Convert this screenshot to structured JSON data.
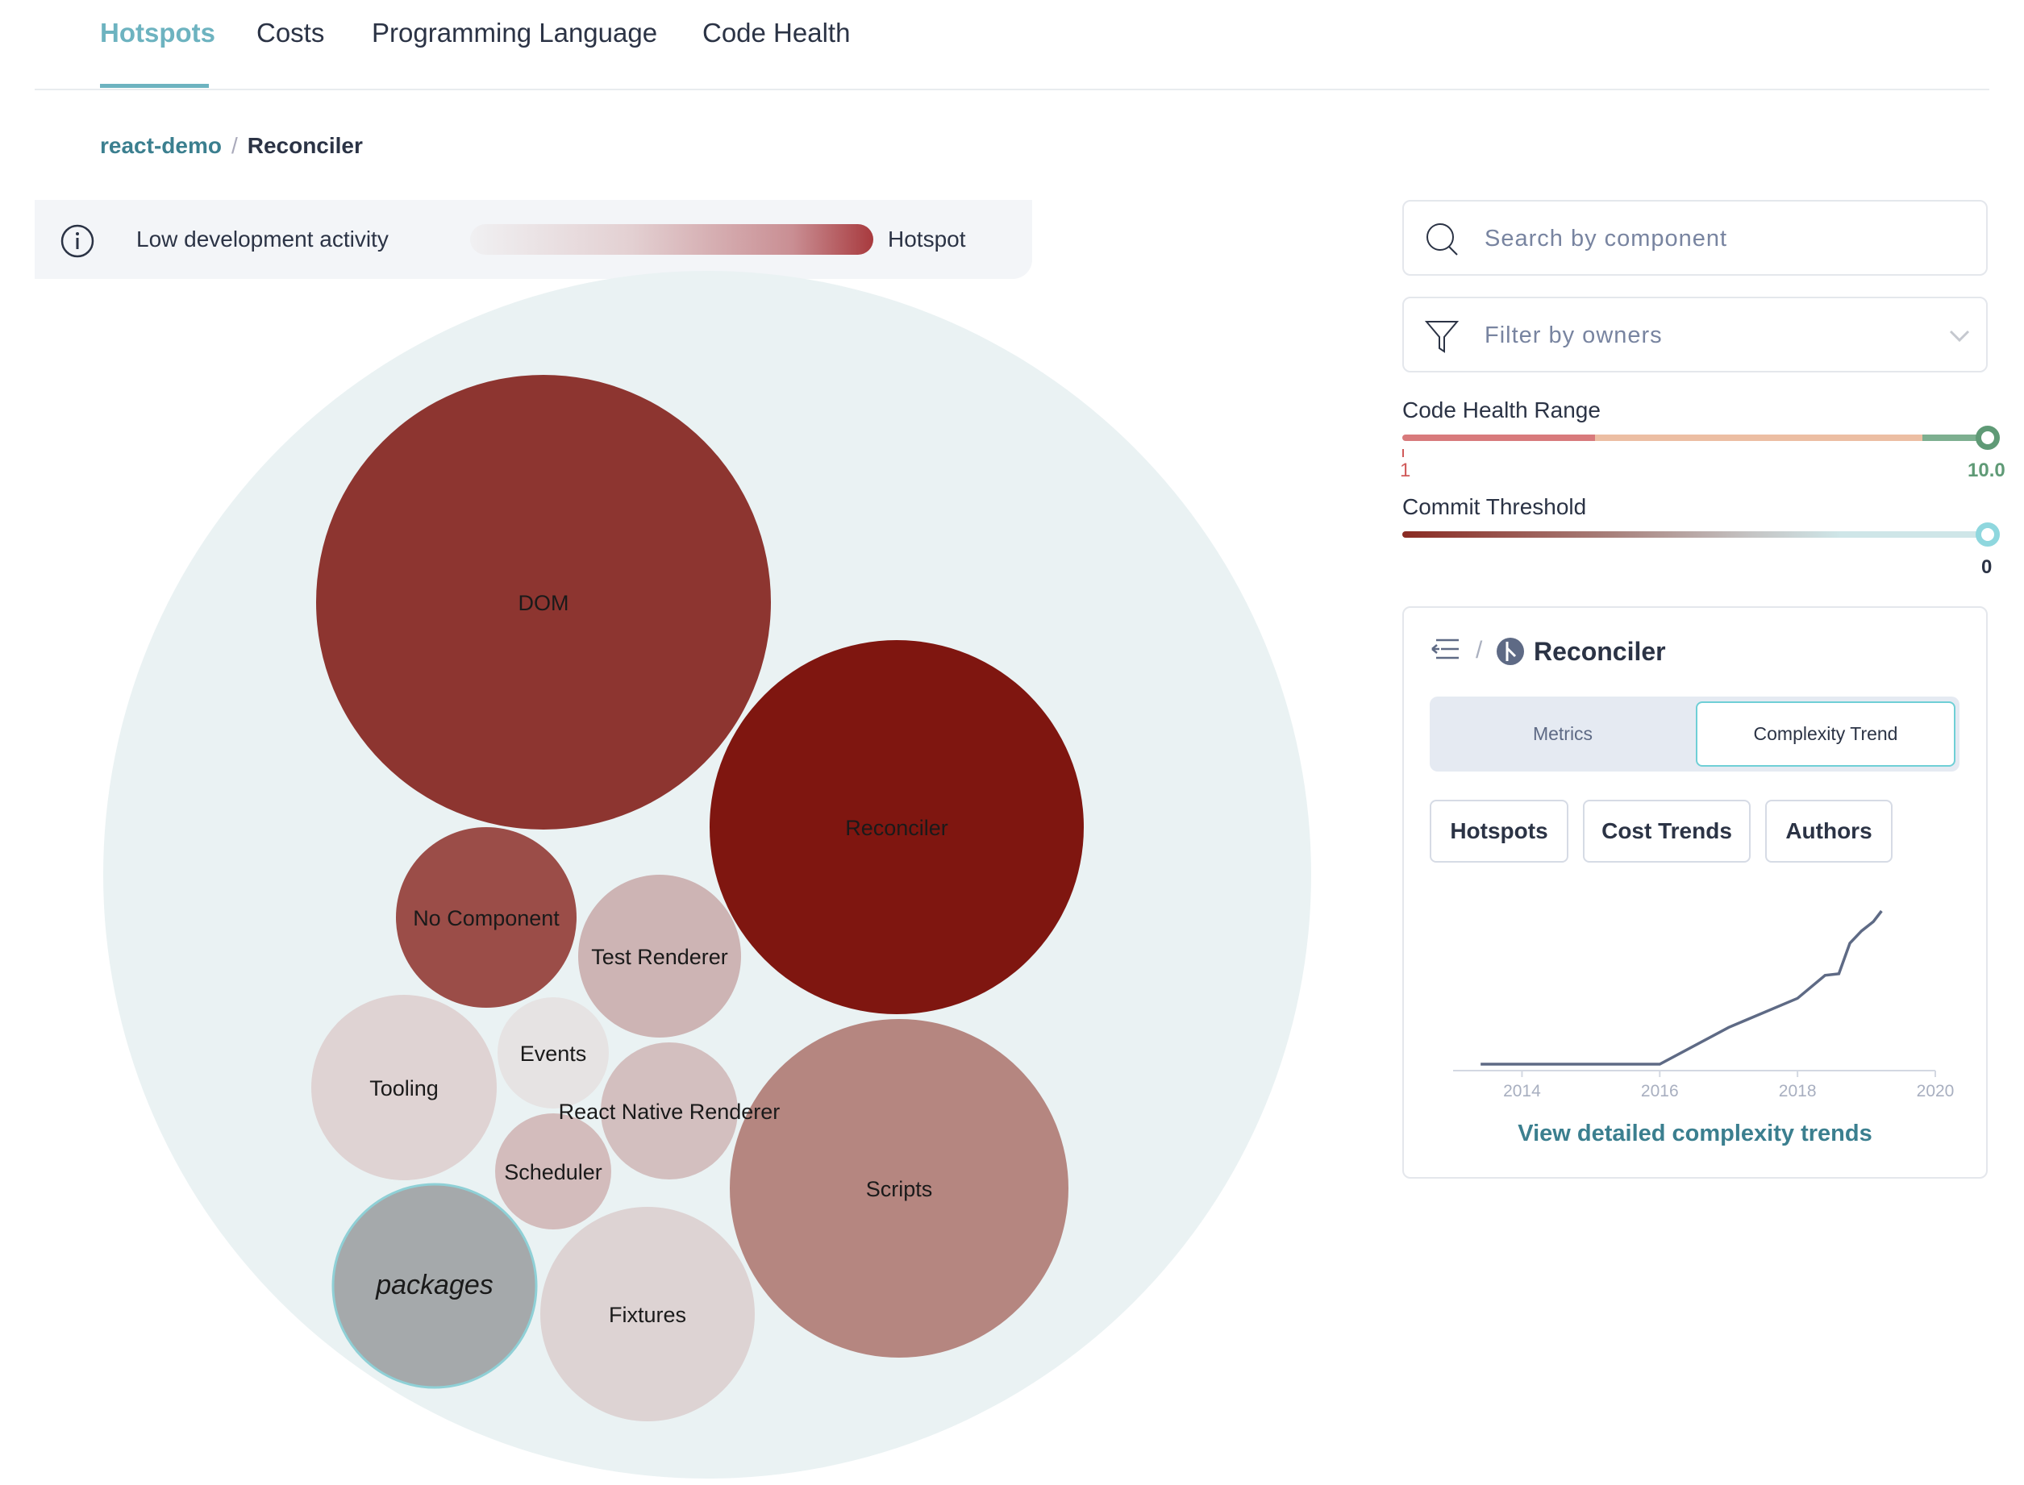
{
  "tabs": [
    {
      "label": "Hotspots",
      "active": true
    },
    {
      "label": "Costs"
    },
    {
      "label": "Programming Language"
    },
    {
      "label": "Code Health"
    }
  ],
  "breadcrumb": {
    "root": "react-demo",
    "separator": "/",
    "current": "Reconciler"
  },
  "legend": {
    "low_label": "Low development activity",
    "high_label": "Hotspot",
    "icon": "info-icon"
  },
  "bubbles": {
    "root": "packages",
    "items": [
      {
        "label": "DOM",
        "color": "#8d3530"
      },
      {
        "label": "Reconciler",
        "color": "#7f1610"
      },
      {
        "label": "No Component",
        "color": "#9b4d48"
      },
      {
        "label": "Test Renderer",
        "color": "#cdb4b4"
      },
      {
        "label": "Tooling",
        "color": "#dfd3d3"
      },
      {
        "label": "Events",
        "color": "#e6e3e3"
      },
      {
        "label": "React Native Renderer",
        "color": "#d3bfbf"
      },
      {
        "label": "Scheduler",
        "color": "#d3bcbc"
      },
      {
        "label": "Scripts",
        "color": "#b58680"
      },
      {
        "label": "packages",
        "color": "#a5a9ab"
      },
      {
        "label": "Fixtures",
        "color": "#ddd3d3"
      }
    ]
  },
  "search": {
    "placeholder": "Search by component",
    "icon": "search-icon"
  },
  "filter": {
    "placeholder": "Filter by owners",
    "icon": "filter-icon"
  },
  "code_health": {
    "label": "Code Health Range",
    "min": "1",
    "max": "10.0"
  },
  "commit_threshold": {
    "label": "Commit Threshold",
    "value": "0"
  },
  "panel": {
    "title": "Reconciler",
    "separator": "/",
    "tabs": [
      "Metrics",
      "Complexity Trend"
    ],
    "active_tab": "Complexity Trend",
    "buttons": [
      "Hotspots",
      "Cost Trends",
      "Authors"
    ],
    "link": "View detailed complexity trends"
  },
  "chart_data": {
    "type": "line",
    "x_ticks": [
      "2014",
      "2016",
      "2018",
      "2020"
    ],
    "xlim": [
      2013,
      2020
    ],
    "series": [
      {
        "x": [
          2013.4,
          2016.0,
          2017.0,
          2018.0,
          2018.4,
          2018.6,
          2018.76,
          2018.93,
          2019.1,
          2019.22
        ],
        "y": [
          0,
          0,
          24,
          43,
          58,
          59,
          79,
          87,
          93,
          100
        ]
      }
    ],
    "color": "#5e6a85"
  }
}
